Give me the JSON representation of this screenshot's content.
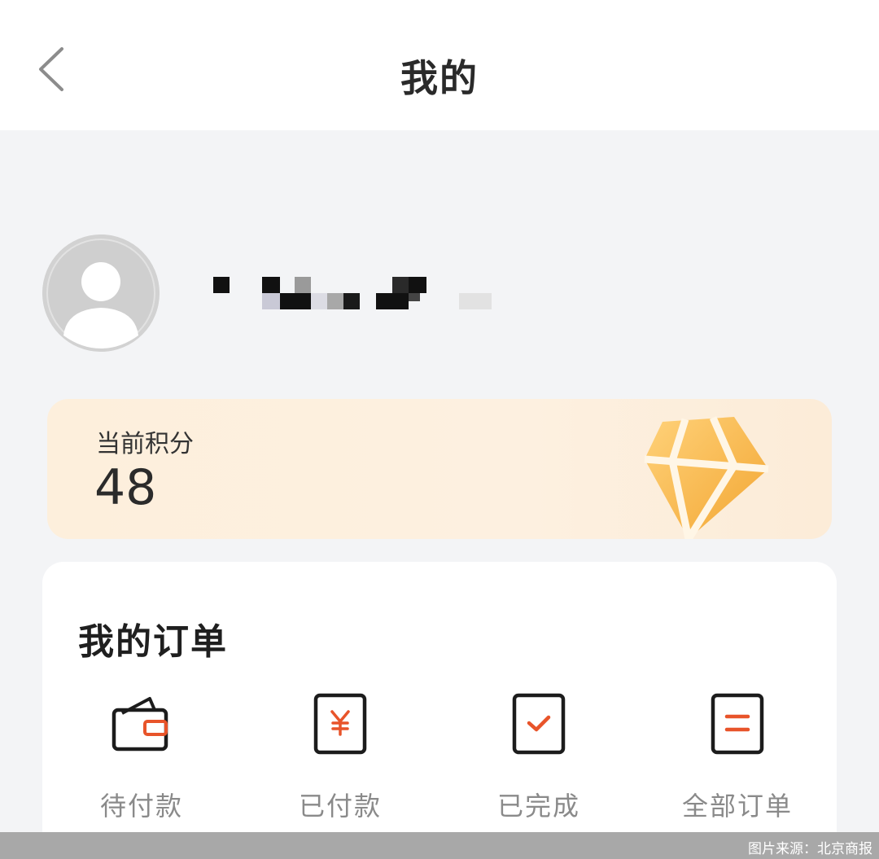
{
  "header": {
    "title": "我的",
    "back_icon": "chevron-left-icon"
  },
  "profile": {
    "avatar_icon": "user-avatar-icon"
  },
  "points": {
    "label": "当前积分",
    "value": "48",
    "icon": "diamond-icon",
    "colors": {
      "card": "#fdefdc",
      "diamond": "#f5b43a"
    }
  },
  "orders": {
    "title": "我的订单",
    "items": [
      {
        "label": "待付款",
        "icon": "wallet-icon"
      },
      {
        "label": "已付款",
        "icon": "yen-receipt-icon"
      },
      {
        "label": "已完成",
        "icon": "checkmark-box-icon"
      },
      {
        "label": "全部订单",
        "icon": "list-document-icon"
      }
    ],
    "accent_color": "#e8542a"
  },
  "watermark": {
    "text": "图片来源：北京商报"
  }
}
